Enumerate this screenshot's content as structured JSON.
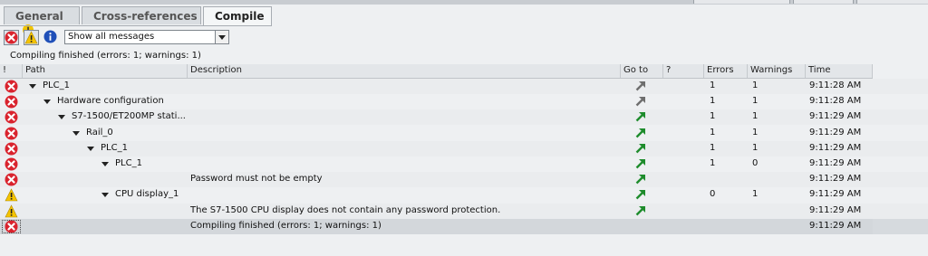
{
  "tabs": [
    {
      "label": "General",
      "has_info": true
    },
    {
      "label": "Cross-references"
    },
    {
      "label": "Compile",
      "active": true
    }
  ],
  "toolbar": {
    "filter_value": "Show all messages"
  },
  "status_line": "Compiling finished (errors: 1; warnings: 1)",
  "columns": {
    "bang": "!",
    "path": "Path",
    "description": "Description",
    "goto": "Go to",
    "q": "?",
    "errors": "Errors",
    "warnings": "Warnings",
    "time": "Time"
  },
  "rows": [
    {
      "status": "error",
      "path": "PLC_1",
      "desc": "",
      "goto": "gray",
      "errors": "1",
      "warnings": "1",
      "time": "9:11:28 AM",
      "expanded": true
    },
    {
      "status": "error",
      "path": "Hardware configuration",
      "desc": "",
      "goto": "gray",
      "errors": "1",
      "warnings": "1",
      "time": "9:11:28 AM",
      "expanded": true
    },
    {
      "status": "error",
      "path": "S7-1500/ET200MP stati...",
      "desc": "",
      "goto": "green",
      "errors": "1",
      "warnings": "1",
      "time": "9:11:29 AM",
      "expanded": true
    },
    {
      "status": "error",
      "path": "Rail_0",
      "desc": "",
      "goto": "green",
      "errors": "1",
      "warnings": "1",
      "time": "9:11:29 AM",
      "expanded": true
    },
    {
      "status": "error",
      "path": "PLC_1",
      "desc": "",
      "goto": "green",
      "errors": "1",
      "warnings": "1",
      "time": "9:11:29 AM",
      "expanded": true
    },
    {
      "status": "error",
      "path": "PLC_1",
      "desc": "",
      "goto": "green",
      "errors": "1",
      "warnings": "0",
      "time": "9:11:29 AM",
      "expanded": true
    },
    {
      "status": "error",
      "path": "",
      "desc": "Password must not be empty",
      "goto": "green",
      "errors": "",
      "warnings": "",
      "time": "9:11:29 AM"
    },
    {
      "status": "warning",
      "path": "CPU display_1",
      "desc": "",
      "goto": "green",
      "errors": "0",
      "warnings": "1",
      "time": "9:11:29 AM",
      "expanded": true
    },
    {
      "status": "warning",
      "path": "",
      "desc": "The S7-1500 CPU display does not contain any password protection.",
      "goto": "green",
      "errors": "",
      "warnings": "",
      "time": "9:11:29 AM"
    },
    {
      "status": "error",
      "path": "",
      "desc": "Compiling finished (errors: 1; warnings: 1)",
      "goto": "",
      "errors": "",
      "warnings": "",
      "time": "9:11:29 AM",
      "selected": true
    }
  ],
  "colors": {
    "error": "#d9232d",
    "warning": "#f5c400",
    "info": "#1f4fb8",
    "goto_green": "#1e8c2c",
    "goto_gray": "#6e6e6e"
  }
}
